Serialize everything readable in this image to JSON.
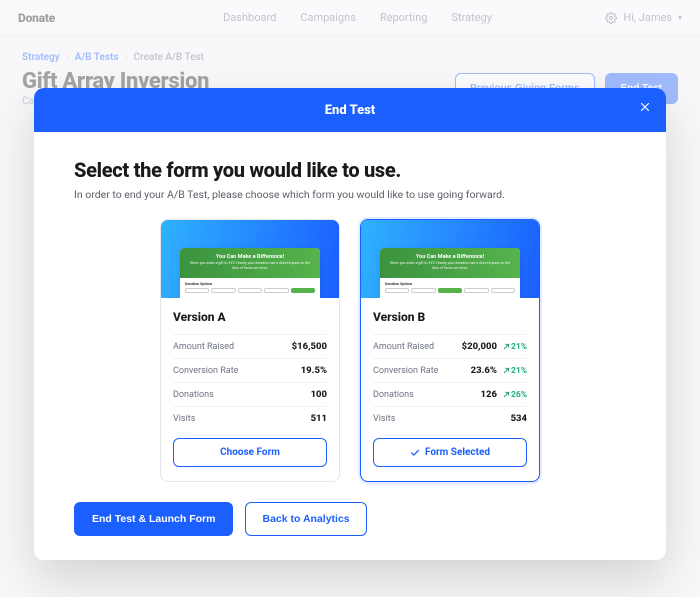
{
  "header": {
    "brand": "Donate",
    "nav": [
      "Dashboard",
      "Campaigns",
      "Reporting",
      "Strategy"
    ],
    "user_greeting": "Hi, James"
  },
  "breadcrumb": {
    "items": [
      "Strategy",
      "A/B Tests",
      "Create A/B Test"
    ]
  },
  "page": {
    "title": "Gift Array Inversion",
    "subtitle_prefix": "Ca",
    "buttons": {
      "previous": "Previous Giving Forms",
      "end": "End Test"
    }
  },
  "modal": {
    "header": "End Test",
    "title": "Select the form you would like to use.",
    "subtitle": "In order to end your A/B Test, please choose which form you would like to use going forward.",
    "preview_banner_title": "You Can Make a Difference!",
    "preview_banner_sub": "When you make a gift to XYZ Charity your donation has a direct impact on the lives of those we serve.",
    "preview_section_label": "Donation Options",
    "cards": [
      {
        "name": "Version A",
        "selected": false,
        "stats": [
          {
            "label": "Amount Raised",
            "value": "$16,500",
            "delta": null
          },
          {
            "label": "Conversion Rate",
            "value": "19.5%",
            "delta": null
          },
          {
            "label": "Donations",
            "value": "100",
            "delta": null
          },
          {
            "label": "Visits",
            "value": "511",
            "delta": null
          }
        ],
        "button_label": "Choose Form"
      },
      {
        "name": "Version B",
        "selected": true,
        "stats": [
          {
            "label": "Amount Raised",
            "value": "$20,000",
            "delta": "21%"
          },
          {
            "label": "Conversion Rate",
            "value": "23.6%",
            "delta": "21%"
          },
          {
            "label": "Donations",
            "value": "126",
            "delta": "26%"
          },
          {
            "label": "Visits",
            "value": "534",
            "delta": null
          }
        ],
        "button_label": "Form Selected"
      }
    ],
    "footer": {
      "primary": "End Test & Launch Form",
      "secondary": "Back to Analytics"
    }
  }
}
